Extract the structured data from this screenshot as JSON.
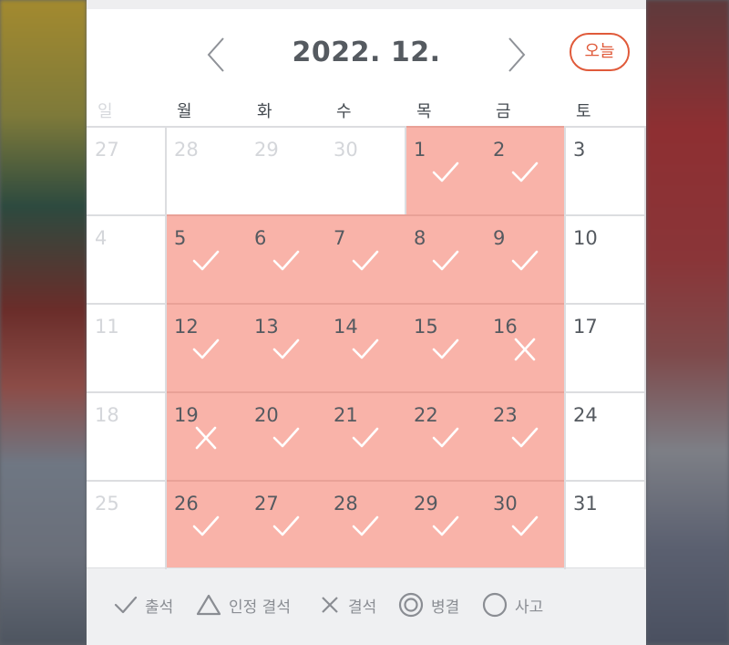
{
  "header": {
    "title": "2022. 12.",
    "today_label": "오늘",
    "prev_icon": "chevron-left-icon",
    "next_icon": "chevron-right-icon"
  },
  "weekdays": [
    "일",
    "월",
    "화",
    "수",
    "목",
    "금",
    "토"
  ],
  "colors": {
    "attendance_fill": "#f9b3a9",
    "accent": "#e05a3a",
    "text": "#555a60",
    "muted": "#d4d6da"
  },
  "weeks": [
    [
      {
        "day": "27",
        "other": true,
        "mark": ""
      },
      {
        "day": "28",
        "other": true,
        "mark": ""
      },
      {
        "day": "29",
        "other": true,
        "mark": ""
      },
      {
        "day": "30",
        "other": true,
        "mark": ""
      },
      {
        "day": "1",
        "other": false,
        "mark": "check"
      },
      {
        "day": "2",
        "other": false,
        "mark": "check"
      },
      {
        "day": "3",
        "other": false,
        "mark": ""
      }
    ],
    [
      {
        "day": "4",
        "other": false,
        "mark": ""
      },
      {
        "day": "5",
        "other": false,
        "mark": "check"
      },
      {
        "day": "6",
        "other": false,
        "mark": "check"
      },
      {
        "day": "7",
        "other": false,
        "mark": "check"
      },
      {
        "day": "8",
        "other": false,
        "mark": "check"
      },
      {
        "day": "9",
        "other": false,
        "mark": "check"
      },
      {
        "day": "10",
        "other": false,
        "mark": ""
      }
    ],
    [
      {
        "day": "11",
        "other": false,
        "mark": ""
      },
      {
        "day": "12",
        "other": false,
        "mark": "check"
      },
      {
        "day": "13",
        "other": false,
        "mark": "check"
      },
      {
        "day": "14",
        "other": false,
        "mark": "check"
      },
      {
        "day": "15",
        "other": false,
        "mark": "check"
      },
      {
        "day": "16",
        "other": false,
        "mark": "x"
      },
      {
        "day": "17",
        "other": false,
        "mark": ""
      }
    ],
    [
      {
        "day": "18",
        "other": false,
        "mark": ""
      },
      {
        "day": "19",
        "other": false,
        "mark": "x"
      },
      {
        "day": "20",
        "other": false,
        "mark": "check"
      },
      {
        "day": "21",
        "other": false,
        "mark": "check"
      },
      {
        "day": "22",
        "other": false,
        "mark": "check"
      },
      {
        "day": "23",
        "other": false,
        "mark": "check"
      },
      {
        "day": "24",
        "other": false,
        "mark": ""
      }
    ],
    [
      {
        "day": "25",
        "other": false,
        "mark": ""
      },
      {
        "day": "26",
        "other": false,
        "mark": "check"
      },
      {
        "day": "27",
        "other": false,
        "mark": "check"
      },
      {
        "day": "28",
        "other": false,
        "mark": "check"
      },
      {
        "day": "29",
        "other": false,
        "mark": "check"
      },
      {
        "day": "30",
        "other": false,
        "mark": "check"
      },
      {
        "day": "31",
        "other": false,
        "mark": ""
      }
    ]
  ],
  "legend": [
    {
      "icon": "check-icon",
      "label": "출석"
    },
    {
      "icon": "triangle-icon",
      "label": "인정 결석"
    },
    {
      "icon": "x-icon",
      "label": "결석"
    },
    {
      "icon": "double-circle-icon",
      "label": "병결"
    },
    {
      "icon": "circle-icon",
      "label": "사고"
    }
  ]
}
